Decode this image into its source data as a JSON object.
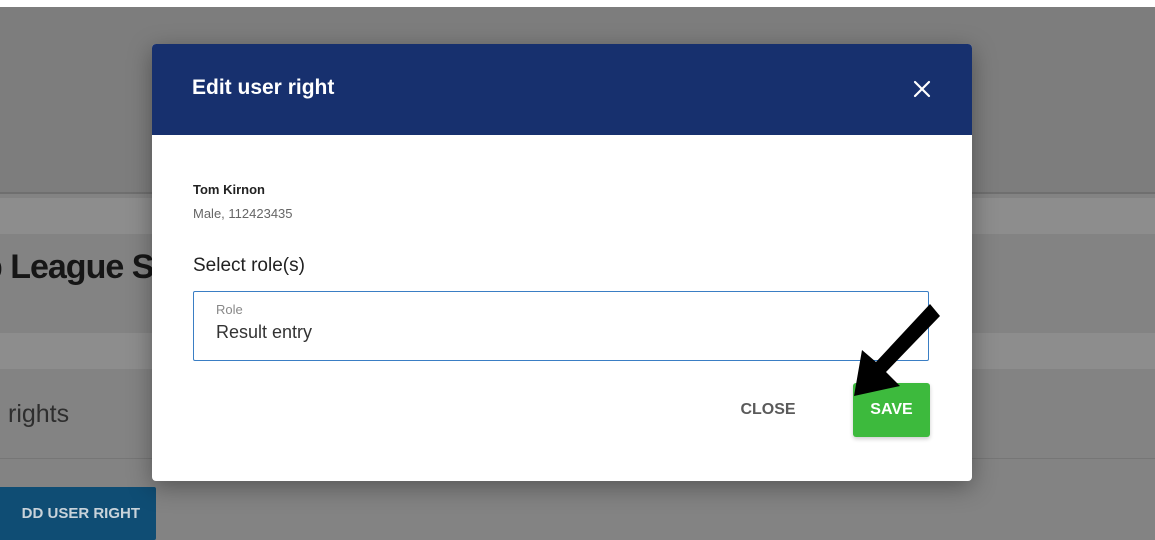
{
  "background": {
    "section_title": "b League S",
    "subtitle": "rights",
    "add_button_label": "DD USER RIGHT"
  },
  "modal": {
    "title": "Edit user right",
    "close_icon": "close-icon",
    "user": {
      "name": "Tom Kirnon",
      "meta": "Male, 112423435"
    },
    "select_label": "Select role(s)",
    "role_field": {
      "label": "Role",
      "value": "Result entry"
    },
    "close_button_label": "CLOSE",
    "save_button_label": "SAVE"
  },
  "colors": {
    "header": "#17306e",
    "save": "#3dba3d",
    "field_border": "#3a7ec4"
  },
  "annotation_icon": "arrow-pointer-icon"
}
